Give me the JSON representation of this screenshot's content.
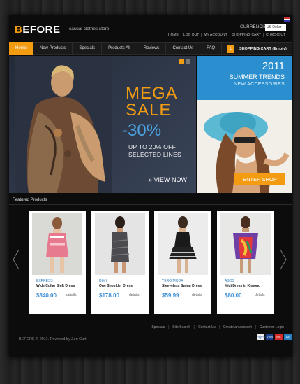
{
  "header": {
    "logo_b": "B",
    "logo_rest": "EFORE",
    "tagline": "casual clothes store",
    "currencies_label": "CURRENCIES",
    "currency_value": "US Dollar",
    "top_links": [
      "HOME",
      "LOG OUT",
      "MY ACCOUNT",
      "SHOPPING CART",
      "CHECKOUT"
    ]
  },
  "nav": {
    "items": [
      "Home",
      "New Products",
      "Specials",
      "Products All",
      "Reviews",
      "Contact Us",
      "FAQ"
    ],
    "cart_label": "SHOPPING CART (Empty)"
  },
  "banner": {
    "mega": "MEGA",
    "sale": "SALE",
    "percent": "-30%",
    "upto": "UP TO 20% OFF",
    "selected": "SELECTED LINES",
    "view_now": "» VIEW NOW",
    "year": "2011",
    "summer": "SUMMER TRENDS",
    "new_acc": "NEW ACCESSORIES",
    "enter": "ENTER SHOP"
  },
  "featured": {
    "heading": "Featured Products",
    "products": [
      {
        "brand": "EXPRESS",
        "name": "Wide Collar Shift Dress",
        "price": "$340.00",
        "details": "details"
      },
      {
        "brand": "DIMY",
        "name": "One Shoulder Dress",
        "price": "$178.00",
        "details": "details"
      },
      {
        "brand": "YERO MODA",
        "name": "Sleeveless Swing Dress",
        "price": "$59.99",
        "details": "details"
      },
      {
        "brand": "ASOS",
        "name": "Midi Dress in Kimono",
        "price": "$80.00",
        "details": "details"
      }
    ]
  },
  "footer": {
    "links": [
      "Specials",
      "Site Search",
      "Contact Us",
      "Create an account",
      "Customer Login"
    ],
    "copyright": "BEFORE © 2011.   Powered by Zen Cart",
    "payment": [
      "PayPal",
      "VISA",
      "MC",
      "AE"
    ]
  },
  "colors": {
    "accent": "#f39c12",
    "blue": "#2b8fcf"
  }
}
